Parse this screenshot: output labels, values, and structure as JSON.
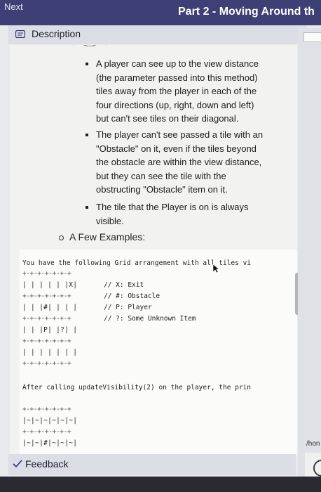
{
  "topbar": {
    "next_label": "Next",
    "title": "Part 2 - Moving Around th"
  },
  "description": {
    "label": "Description"
  },
  "bullets": [
    {
      "lines": [
        "A player can see up to the view distance",
        "(the parameter passed into this method)",
        "tiles away from the player in each of the",
        "four directions (up, right, down and left)",
        "but can't see tiles on their diagonal."
      ]
    },
    {
      "lines": [
        "The player can't see passed a tile with an",
        "\"Obstacle\" on it, even if the tiles beyond",
        "the obstacle are within the view distance,",
        "but they can see the tile with the",
        "obstructing \"Obstacle\" item on it."
      ]
    },
    {
      "lines": [
        "The tile that the Player is on is always",
        "visible."
      ]
    }
  ],
  "examples_label": "A Few Examples:",
  "code": {
    "intro": "You have the following Grid arrangement with all tiles vi",
    "grid_border": "+-+-+-+-+-+-+",
    "grid_rows": [
      "| | | | | |X|",
      "| | |#| | | |",
      "| | |P| |?| |",
      "| | | | | | |"
    ],
    "legend": [
      "// X: Exit",
      "// #: Obstacle",
      "// P: Player",
      "// ?: Some Unknown Item"
    ],
    "after": "After calling updateVisibility(2) on the player, the prin",
    "result_rows": [
      "|~|~|~|~|~|~|",
      "|~|~|#|~|~|~|"
    ]
  },
  "right_panel": {
    "text": "/hon"
  },
  "feedback": {
    "label": "Feedback"
  }
}
